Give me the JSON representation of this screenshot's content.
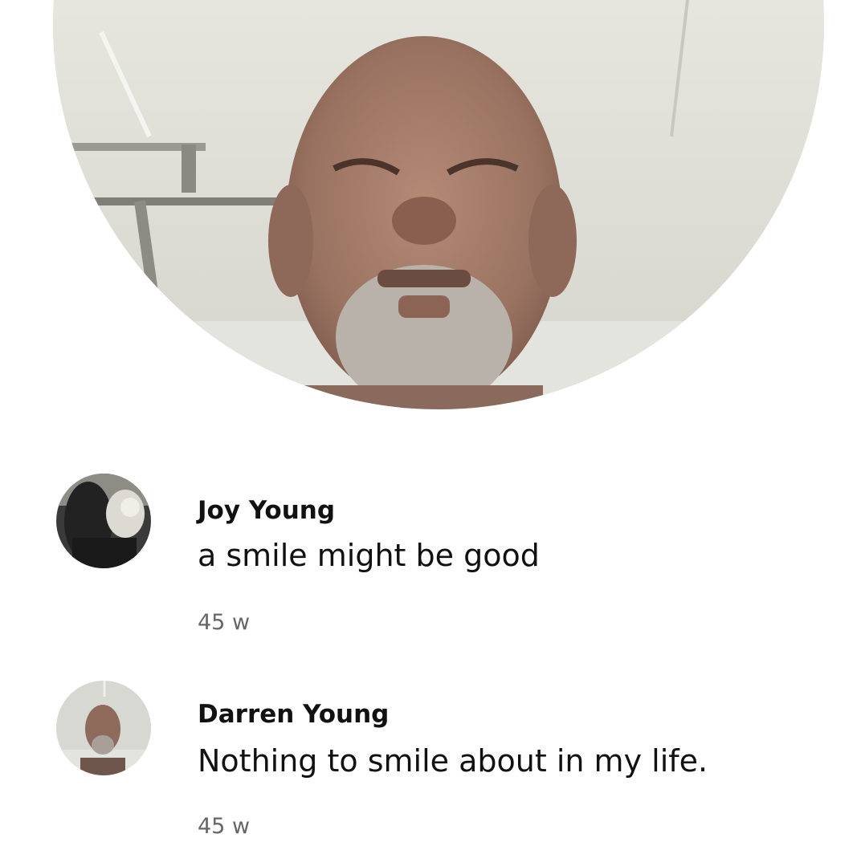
{
  "profile": {
    "photo_icon": "profile-photo"
  },
  "comments": [
    {
      "author": "Joy Young",
      "text": "a smile might be good",
      "time": "45 w"
    },
    {
      "author": "Darren Young",
      "text": "Nothing to smile about in my life.",
      "time": "45 w"
    }
  ],
  "colors": {
    "background": "#ffffff",
    "text": "#111111",
    "timestamp": "#666666"
  }
}
